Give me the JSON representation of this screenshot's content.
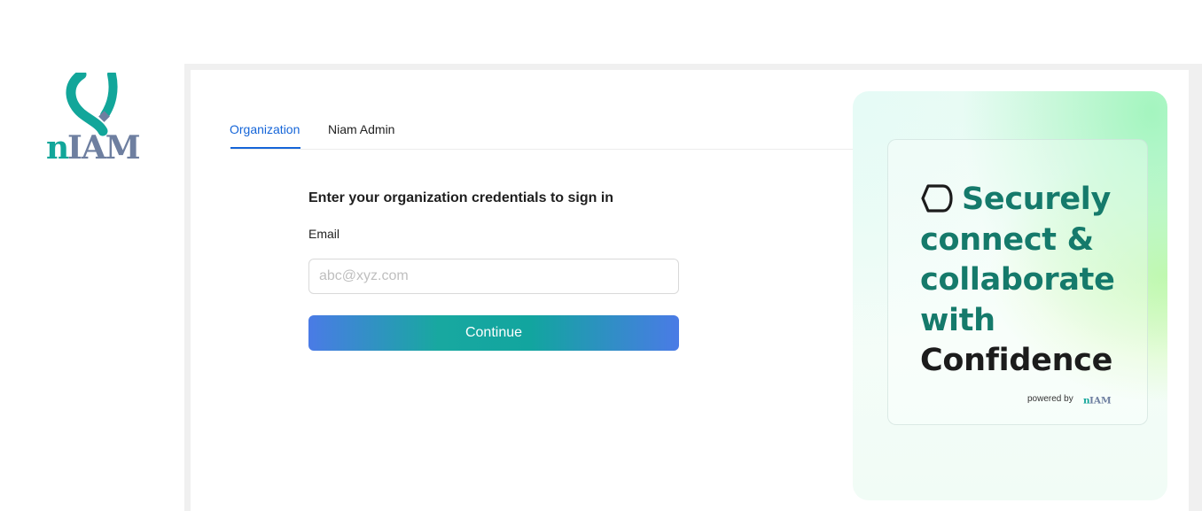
{
  "brand": {
    "logo_text": "nIAM",
    "colors": {
      "teal": "#12a69a",
      "slate": "#6e7fa0",
      "accent": "#1565d8"
    }
  },
  "tabs": [
    {
      "label": "Organization",
      "active": true
    },
    {
      "label": "Niam Admin",
      "active": false
    }
  ],
  "form": {
    "heading": "Enter your organization credentials to sign in",
    "email_label": "Email",
    "email_placeholder": "abc@xyz.com",
    "email_value": "",
    "continue_label": "Continue"
  },
  "promo": {
    "icon": "speech-bubble-icon",
    "line1": "Securely",
    "line2": "connect &",
    "line3": "collaborate",
    "line4": "with",
    "line5": "Confidence",
    "powered_by": "powered by",
    "powered_logo_text": "nIAM"
  }
}
